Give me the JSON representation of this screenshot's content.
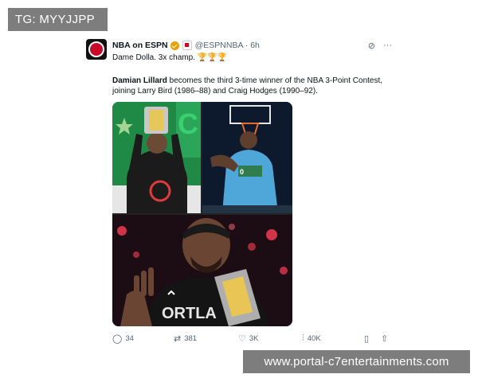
{
  "overlay_tag": "TG: MYYJJPP",
  "watermark": "www.portal-c7entertainments.com",
  "tweet": {
    "author_name": "NBA on ESPN",
    "handle_time": "@ESPNNBA · 6h",
    "line1": "Dame Dolla. 3x champ.",
    "trophies": "🏆🏆🏆",
    "bold_name": "Damian Lillard",
    "body_rest": " becomes the third 3-time winner of the NBA 3-Point Contest, joining Larry Bird (1986–88) and Craig Hodges (1990–92).",
    "jersey_text": "ORTLA",
    "replies": "34",
    "retweets": "381",
    "likes": "3K",
    "views": "40K"
  },
  "icons": {
    "avatar": "nba-espn-logo-icon",
    "verified": "verified-badge-icon",
    "affiliation": "affiliate-badge-icon",
    "grok": "grok-icon",
    "more": "more-icon",
    "reply": "reply-icon",
    "retweet": "retweet-icon",
    "like": "heart-icon",
    "views": "views-icon",
    "bookmark": "bookmark-icon",
    "share": "share-icon"
  }
}
